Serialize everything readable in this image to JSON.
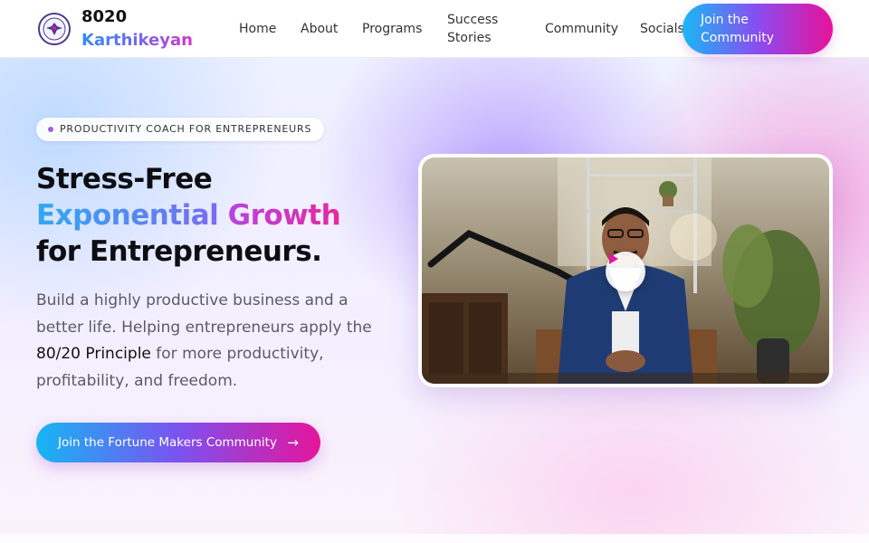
{
  "brand": {
    "line1": "8020",
    "line2": "Karthikeyan",
    "logo_icon": "eagle-emblem-icon"
  },
  "nav": {
    "home": "Home",
    "about": "About",
    "programs": "Programs",
    "success_stories": "Success Stories",
    "community": "Community",
    "socials": "Socials"
  },
  "header_cta": "Join the Community",
  "hero": {
    "badge": "PRODUCTIVITY COACH FOR ENTREPRENEURS",
    "heading_line1": "Stress-Free",
    "heading_line2a": "Exponential",
    "heading_line2b": "Growth",
    "heading_line3": "for Entrepreneurs.",
    "desc_part1": "Build a highly productive business and a better life. Helping entrepreneurs apply the ",
    "desc_strong": "80/20 Principle",
    "desc_part2": " for more productivity, profitability, and freedom.",
    "cta_label": "Join the Fortune Makers Community",
    "cta_icon": "arrow-right-icon"
  },
  "video": {
    "play_icon": "play-icon"
  },
  "colors": {
    "accent_blue": "#19b8f5",
    "accent_purple": "#8a4cf0",
    "accent_pink": "#e8129a",
    "play_pink": "#e5159c"
  }
}
